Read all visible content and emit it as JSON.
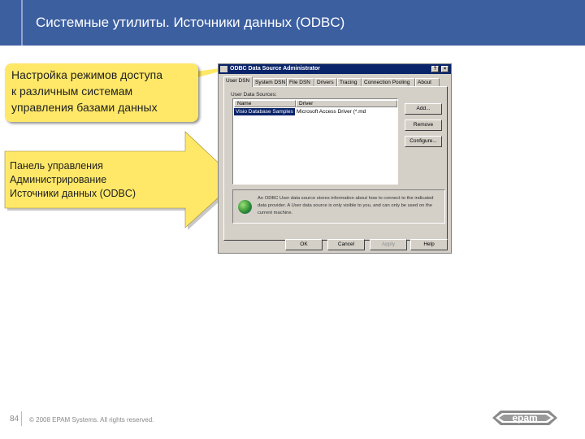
{
  "slide": {
    "title": "Системные утилиты. Источники данных (ODBC)",
    "callout_top": "Настройка режимов доступа\nк различным системам\nуправления базами данных",
    "callout_arrow": "Панель управления\nАдминистрирование\nИсточники данных (ODBC)",
    "page_number": "84",
    "copyright": "© 2008  EPAM Systems. All rights reserved.",
    "logo_text": "epam",
    "colors": {
      "header": "#3c5fa0",
      "callout": "#ffe868",
      "dialog_title": "#0a246a",
      "dialog_face": "#d4d0c8"
    }
  },
  "dialog": {
    "title": "ODBC Data Source Administrator",
    "help_glyph": "?",
    "close_glyph": "×",
    "tabs": [
      "User DSN",
      "System DSN",
      "File DSN",
      "Drivers",
      "Tracing",
      "Connection Pooling",
      "About"
    ],
    "group_label": "User Data Sources:",
    "columns": [
      "Name",
      "Driver"
    ],
    "rows": [
      {
        "name": "Visio Database Samples",
        "driver": "Microsoft Access Driver (*.md"
      }
    ],
    "side_buttons": [
      "Add...",
      "Remove",
      "Configure..."
    ],
    "info_text": "An ODBC User data source stores information about how to connect to the indicated data provider.  A User data source is only visible to you, and can only be used on the current machine.",
    "bottom_buttons": [
      "OK",
      "Cancel",
      "Apply",
      "Help"
    ],
    "icons": [
      "app-icon",
      "globe-icon"
    ]
  }
}
